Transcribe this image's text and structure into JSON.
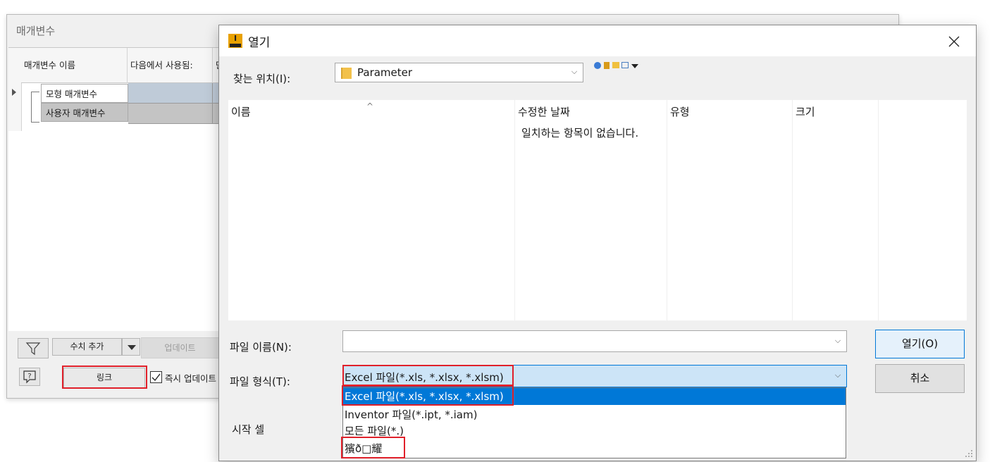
{
  "param_window": {
    "title": "매개변수",
    "columns": [
      "매개변수 이름",
      "다음에서 사용됨:",
      "단"
    ],
    "tree": [
      "모형 매개변수",
      "사용자 매개변수"
    ],
    "buttons": {
      "add_numeric": "수치 추가",
      "update": "업데이트",
      "link": "링크",
      "immediate_update": "즉시 업데이트"
    }
  },
  "open_dialog": {
    "title": "열기",
    "look_in_label": "찾는 위치(I):",
    "look_in_value": "Parameter",
    "columns": {
      "name": "이름",
      "modified": "수정한 날짜",
      "type": "유형",
      "size": "크기"
    },
    "empty_message": "일치하는 항목이 없습니다.",
    "file_name_label": "파일 이름(N):",
    "file_name_value": "",
    "file_type_label": "파일 형식(T):",
    "file_type_value": "Excel 파일(*.xls, *.xlsx, *.xlsm)",
    "file_type_options": [
      "Excel 파일(*.xls, *.xlsx, *.xlsm)",
      "Inventor 파일(*.ipt, *.iam)",
      "모든 파일(*.)",
      "獱ð□耀"
    ],
    "start_cell_label": "시작 셀",
    "open_button": "열기(O)",
    "cancel_button": "취소"
  },
  "colors": {
    "highlight": "#0078d7",
    "annotation_red": "#e0202a",
    "grid_blue": "#bfcbd8",
    "grid_gray": "#c4c4c4"
  }
}
